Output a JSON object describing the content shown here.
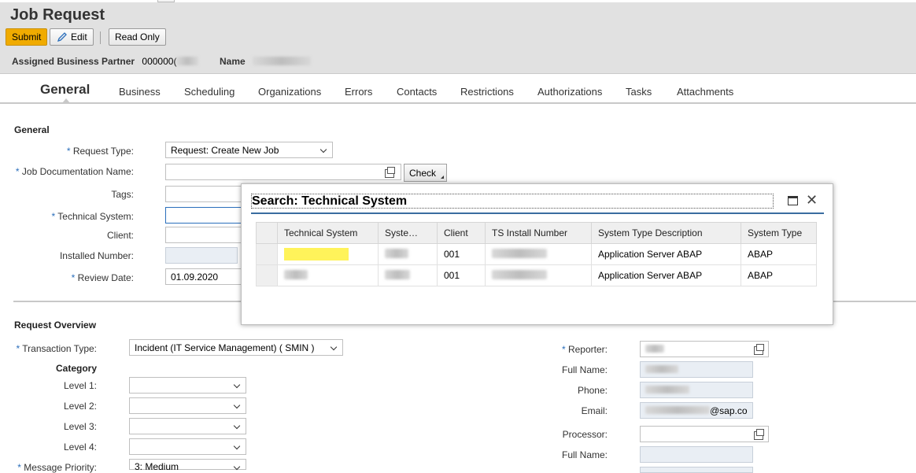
{
  "header": {
    "title": "Job Request",
    "buttons": {
      "submit": "Submit",
      "edit": "Edit",
      "read_only": "Read Only"
    },
    "business_partner": {
      "label": "Assigned Business Partner",
      "value_visible": "000000(",
      "name_label": "Name"
    }
  },
  "tabs": [
    "General",
    "Business",
    "Scheduling",
    "Organizations",
    "Errors",
    "Contacts",
    "Restrictions",
    "Authorizations",
    "Tasks",
    "Attachments"
  ],
  "general": {
    "section_title": "General",
    "request_type_label": "Request Type:",
    "request_type_value": "Request: Create New Job",
    "job_doc_name_label": "Job Documentation Name:",
    "check_button": "Check",
    "tags_label": "Tags:",
    "technical_system_label": "Technical System:",
    "client_label": "Client:",
    "installed_number_label": "Installed Number:",
    "review_date_label": "Review Date:",
    "review_date_value": "01.09.2020"
  },
  "overview": {
    "section_title": "Request Overview",
    "transaction_type_label": "Transaction Type:",
    "transaction_type_value": "Incident  (IT Service Management) ( SMIN )",
    "category_label": "Category",
    "level_labels": [
      "Level 1:",
      "Level 2:",
      "Level 3:",
      "Level 4:"
    ],
    "message_priority_label": "Message Priority:",
    "message_priority_value": "3: Medium",
    "reporter_label": "Reporter:",
    "full_name_label": "Full Name:",
    "phone_label": "Phone:",
    "email_label": "Email:",
    "email_suffix": "@sap.co",
    "processor_label": "Processor:",
    "processor_full_name_label": "Full Name:",
    "required_mark": "*"
  },
  "dialog": {
    "title": "Search: Technical System",
    "columns": [
      "Technical System",
      "Syste…",
      "Client",
      "TS Install Number",
      "System Type Description",
      "System Type"
    ],
    "rows": [
      {
        "client": "001",
        "description": "Application Server ABAP",
        "type": "ABAP"
      },
      {
        "client": "001",
        "description": "Application Server ABAP",
        "type": "ABAP"
      }
    ]
  },
  "colors": {
    "accent_submit": "#f0ab00",
    "required": "#2a6ebb",
    "highlight": "#fff35a",
    "dialog_rule": "#3a6da0"
  }
}
